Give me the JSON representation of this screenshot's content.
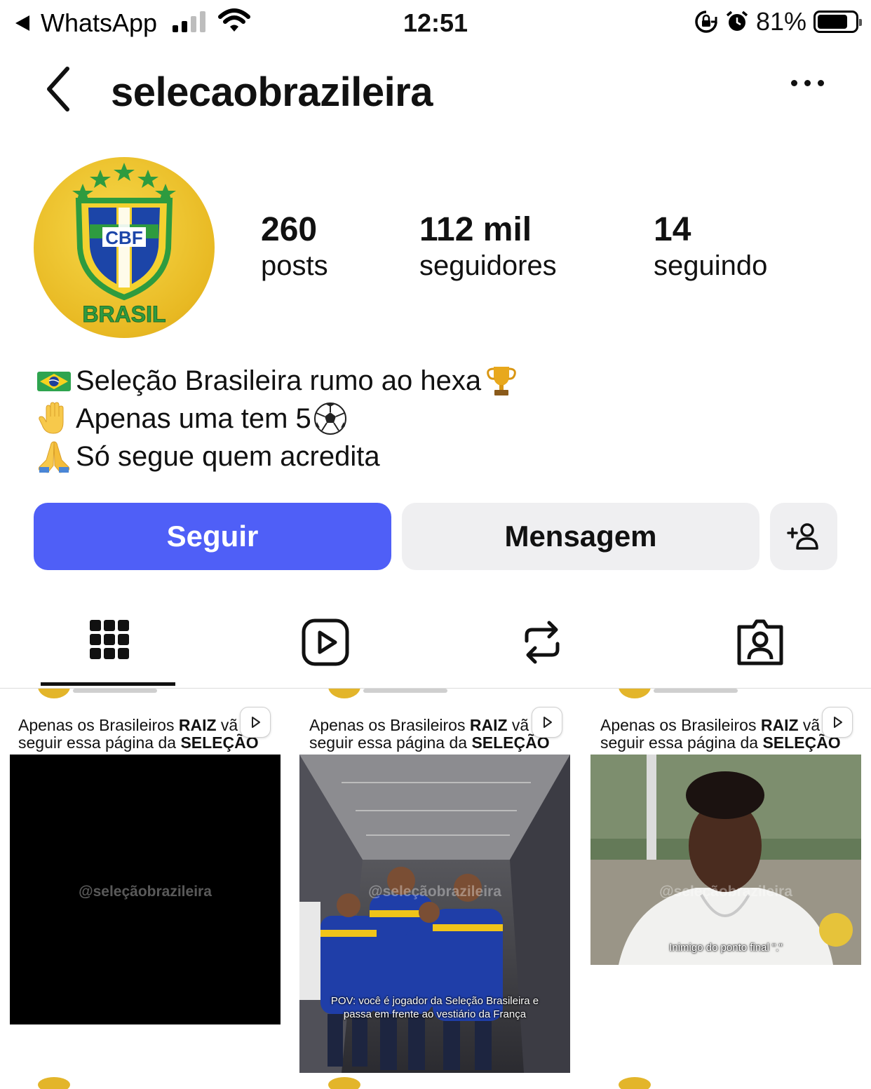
{
  "status_bar": {
    "back_app": "WhatsApp",
    "time": "12:51",
    "battery": "81%",
    "battery_level": 0.81
  },
  "header": {
    "username": "selecaobrazileira"
  },
  "profile": {
    "avatar_text_top": "CBF",
    "avatar_text_bottom": "BRASIL",
    "stats": [
      {
        "value": "260",
        "label": "posts"
      },
      {
        "value": "112 mil",
        "label": "seguidores"
      },
      {
        "value": "14",
        "label": "seguindo"
      }
    ],
    "bio": [
      {
        "emoji": "brazil-flag",
        "text": "Seleção Brasileira rumo ao hexa",
        "trailing_emoji": "trophy"
      },
      {
        "emoji": "raised-hand",
        "text": " Apenas uma tem 5",
        "trailing_emoji": "soccer-ball"
      },
      {
        "emoji": "folded-hands",
        "text": "Só segue quem acredita",
        "trailing_emoji": ""
      }
    ]
  },
  "actions": {
    "follow_label": "Seguir",
    "message_label": "Mensagem"
  },
  "tabs": [
    "grid",
    "reels",
    "reposts",
    "tagged"
  ],
  "posts": [
    {
      "caption_line1_pre": "Apenas os Brasileiros ",
      "caption_line1_bold": "RAIZ",
      "caption_line1_post": " vã",
      "caption_line2_pre": "seguir essa página da ",
      "caption_line2_bold": "SELEÇÃO",
      "watermark": "@seleçãobrazileira",
      "overlay": ""
    },
    {
      "caption_line1_pre": "Apenas os Brasileiros ",
      "caption_line1_bold": "RAIZ",
      "caption_line1_post": " vã",
      "caption_line2_pre": "seguir essa página da ",
      "caption_line2_bold": "SELEÇÃO",
      "watermark": "@seleçãobrazileira",
      "overlay_line1": "POV: você é jogador da Seleção Brasileira e",
      "overlay_line2": "passa em frente ao vestiário da França"
    },
    {
      "caption_line1_pre": "Apenas os Brasileiros ",
      "caption_line1_bold": "RAIZ",
      "caption_line1_post": " vã",
      "caption_line2_pre": "seguir essa página da ",
      "caption_line2_bold": "SELEÇÃO",
      "watermark": "@seleçãobrazileira",
      "overlay_line1": "Inimigo do ponto final \".\""
    }
  ],
  "colors": {
    "follow_button": "#4f5ff7",
    "secondary_button": "#efeff1",
    "text": "#111111"
  }
}
